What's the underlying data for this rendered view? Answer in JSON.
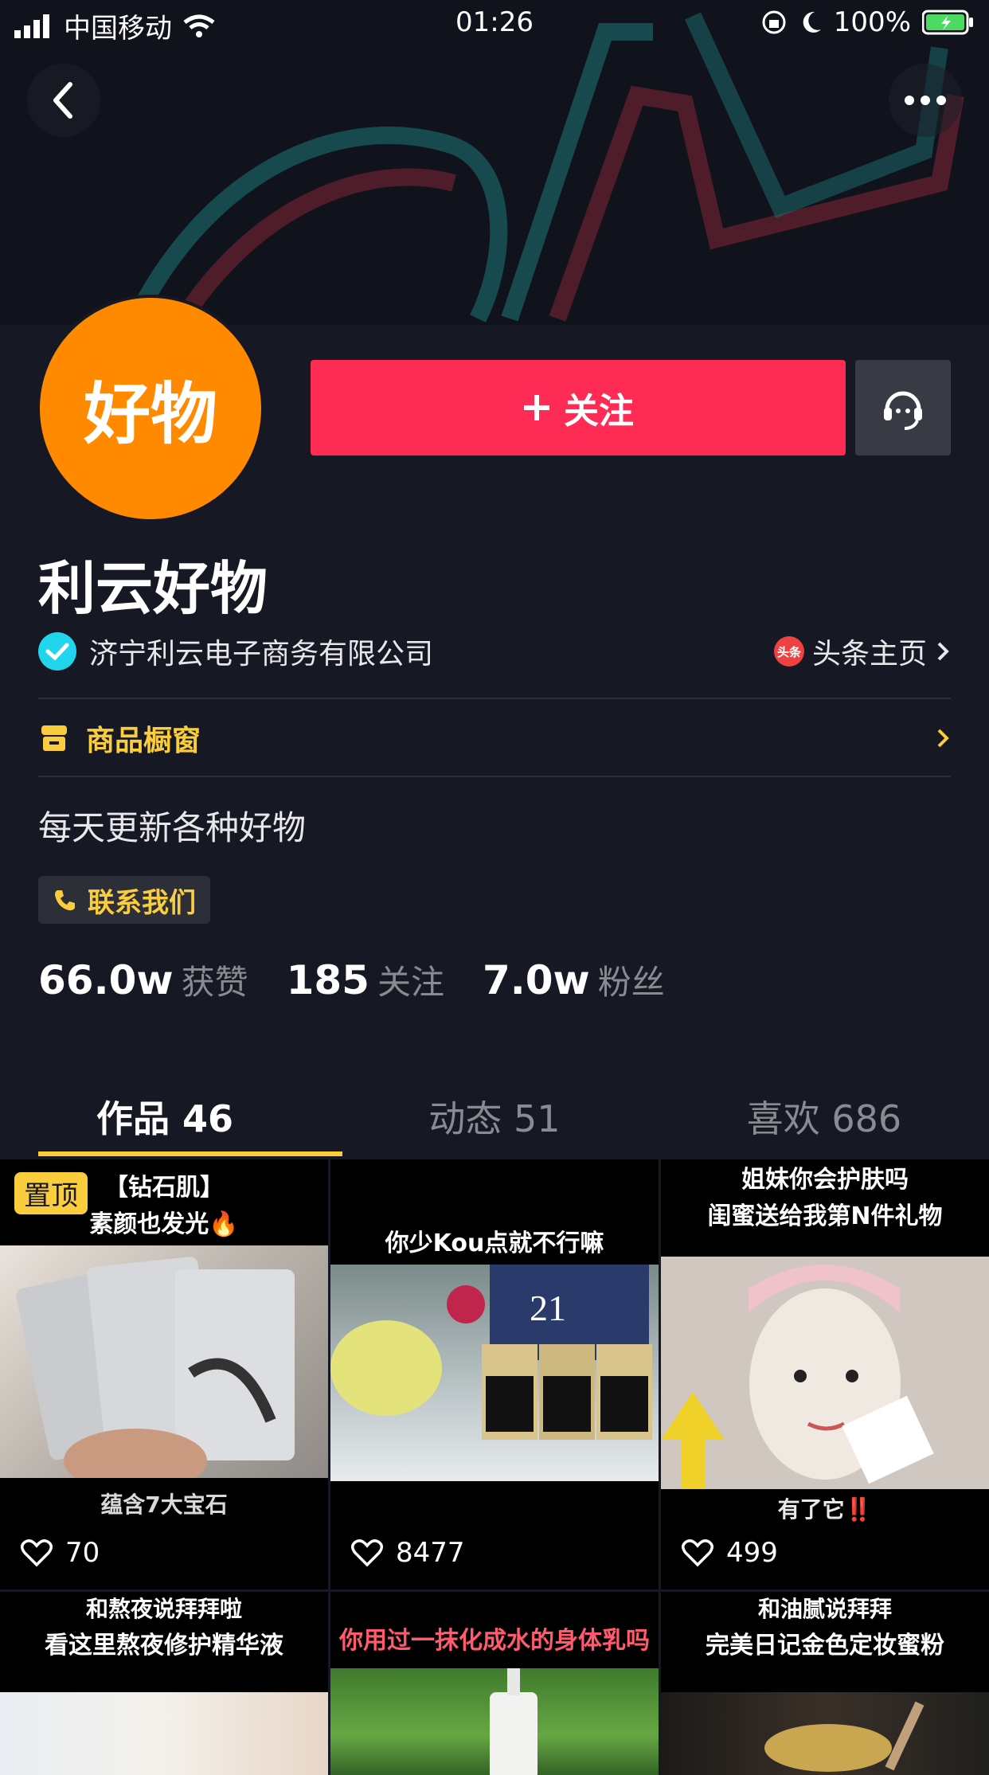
{
  "status": {
    "carrier": "中国移动",
    "time": "01:26",
    "battery": "100%"
  },
  "profile": {
    "avatar_text": "好物",
    "follow_label": "关注",
    "name": "利云好物",
    "verification": "济宁利云电子商务有限公司",
    "toutiao_label": "头条主页",
    "toutiao_icon_text": "头条",
    "shop_label": "商品橱窗",
    "bio": "每天更新各种好物",
    "contact_label": "联系我们"
  },
  "stats": [
    {
      "value": "66.0w",
      "label": "获赞"
    },
    {
      "value": "185",
      "label": "关注"
    },
    {
      "value": "7.0w",
      "label": "粉丝"
    }
  ],
  "tabs": [
    {
      "label": "作品 46",
      "active": true
    },
    {
      "label": "动态 51",
      "active": false
    },
    {
      "label": "喜欢 686",
      "active": false
    }
  ],
  "videos": [
    {
      "caption_top": "【钻石肌】",
      "caption_sub": "素颜也发光🔥",
      "caption_bottom": "蕴含7大宝石",
      "likes": "70",
      "pinned_label": "置顶"
    },
    {
      "caption_top": "你少Kou点就不行嘛",
      "likes": "8477"
    },
    {
      "caption_top": "姐妹你会护肤吗",
      "caption_sub": "闺蜜送给我第N件礼物",
      "caption_bottom": "有了它‼️",
      "likes": "499"
    },
    {
      "caption_top": "和熬夜说拜拜啦",
      "caption_sub": "看这里熬夜修护精华液"
    },
    {
      "caption_sub": "你用过一抹化成水的身体乳吗"
    },
    {
      "caption_top": "和油腻说拜拜",
      "caption_sub": "完美日记金色定妆蜜粉"
    }
  ],
  "colors": {
    "accent": "#fe2c55",
    "yellow": "#facd3d",
    "background": "#161823",
    "verify": "#20d5ec",
    "avatar": "#ff8a00"
  }
}
